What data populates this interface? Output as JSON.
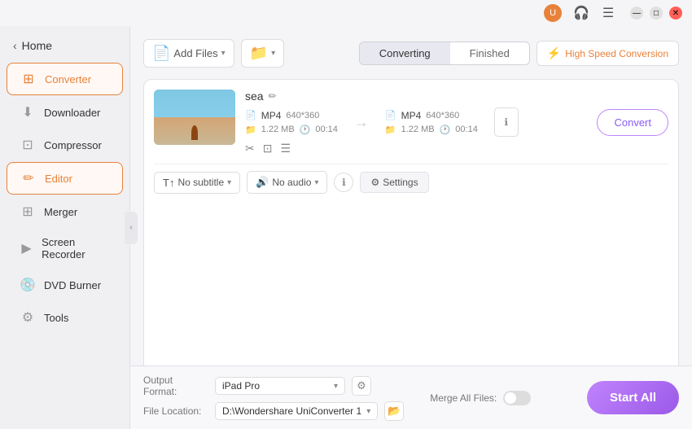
{
  "titlebar": {
    "profile_label": "U",
    "minimize_label": "—",
    "maximize_label": "□",
    "close_label": "✕"
  },
  "sidebar": {
    "home_label": "Home",
    "items": [
      {
        "id": "converter",
        "label": "Converter",
        "active": true
      },
      {
        "id": "downloader",
        "label": "Downloader",
        "active": false
      },
      {
        "id": "compressor",
        "label": "Compressor",
        "active": false
      },
      {
        "id": "editor",
        "label": "Editor",
        "active": true
      },
      {
        "id": "merger",
        "label": "Merger",
        "active": false
      },
      {
        "id": "screen-recorder",
        "label": "Screen Recorder",
        "active": false
      },
      {
        "id": "dvd-burner",
        "label": "DVD Burner",
        "active": false
      },
      {
        "id": "tools",
        "label": "Tools",
        "active": false
      }
    ]
  },
  "topbar": {
    "add_files_label": "Add Files",
    "add_folder_label": "Add Folder",
    "tab_converting": "Converting",
    "tab_finished": "Finished",
    "high_speed_label": "High Speed Conversion"
  },
  "file": {
    "name": "sea",
    "input_format": "MP4",
    "input_resolution": "640*360",
    "input_size": "1.22 MB",
    "input_duration": "00:14",
    "output_format": "MP4",
    "output_resolution": "640*360",
    "output_size": "1.22 MB",
    "output_duration": "00:14",
    "convert_btn": "Convert"
  },
  "controls": {
    "subtitle_label": "No subtitle",
    "audio_label": "No audio",
    "settings_label": "Settings"
  },
  "bottom": {
    "output_format_label": "Output Format:",
    "output_format_value": "iPad Pro",
    "file_location_label": "File Location:",
    "file_location_value": "D:\\Wondershare UniConverter 1",
    "merge_label": "Merge All Files:",
    "start_btn": "Start All"
  }
}
